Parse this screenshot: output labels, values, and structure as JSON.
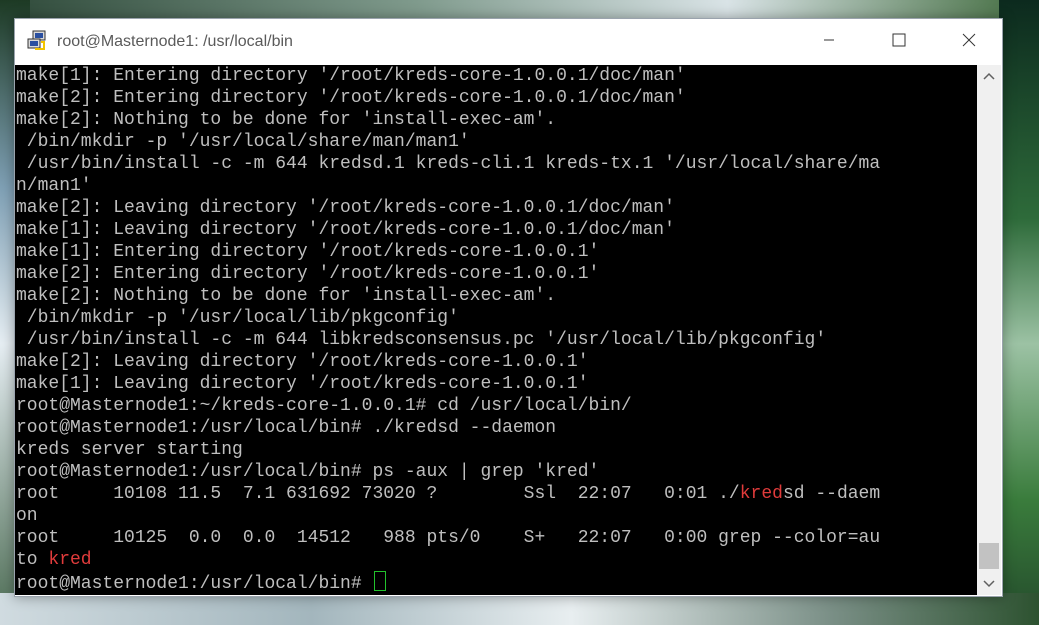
{
  "window": {
    "title": "root@Masternode1: /usr/local/bin",
    "minimize_icon": "minimize-icon",
    "maximize_icon": "maximize-icon",
    "close_icon": "close-icon"
  },
  "colors": {
    "terminal_bg": "#000000",
    "terminal_fg": "#bfbfbf",
    "highlight": "#e03b3b",
    "cursor": "#22c22c"
  },
  "terminal": {
    "lines": [
      "make[1]: Entering directory '/root/kreds-core-1.0.0.1/doc/man'",
      "make[2]: Entering directory '/root/kreds-core-1.0.0.1/doc/man'",
      "make[2]: Nothing to be done for 'install-exec-am'.",
      " /bin/mkdir -p '/usr/local/share/man/man1'",
      " /usr/bin/install -c -m 644 kredsd.1 kreds-cli.1 kreds-tx.1 '/usr/local/share/ma",
      "n/man1'",
      "make[2]: Leaving directory '/root/kreds-core-1.0.0.1/doc/man'",
      "make[1]: Leaving directory '/root/kreds-core-1.0.0.1/doc/man'",
      "make[1]: Entering directory '/root/kreds-core-1.0.0.1'",
      "make[2]: Entering directory '/root/kreds-core-1.0.0.1'",
      "make[2]: Nothing to be done for 'install-exec-am'.",
      " /bin/mkdir -p '/usr/local/lib/pkgconfig'",
      " /usr/bin/install -c -m 644 libkredsconsensus.pc '/usr/local/lib/pkgconfig'",
      "make[2]: Leaving directory '/root/kreds-core-1.0.0.1'",
      "make[1]: Leaving directory '/root/kreds-core-1.0.0.1'",
      "root@Masternode1:~/kreds-core-1.0.0.1# cd /usr/local/bin/",
      "root@Masternode1:/usr/local/bin# ./kredsd --daemon",
      "kreds server starting",
      "root@Masternode1:/usr/local/bin# ps -aux | grep 'kred'"
    ],
    "ps_row1_a": "root     10108 11.5  7.1 631692 73020 ?        Ssl  22:07   0:01 ./",
    "ps_row1_match": "kred",
    "ps_row1_b": "sd --daem",
    "ps_row1_wrap": "on",
    "ps_row2": "root     10125  0.0  0.0  14512   988 pts/0    S+   22:07   0:00 grep --color=au",
    "ps_row2_wrap_a": "to ",
    "ps_row2_match": "kred",
    "prompt": "root@Masternode1:/usr/local/bin# "
  },
  "scrollbar": {
    "up_icon": "chevron-up-icon",
    "down_icon": "chevron-down-icon"
  }
}
